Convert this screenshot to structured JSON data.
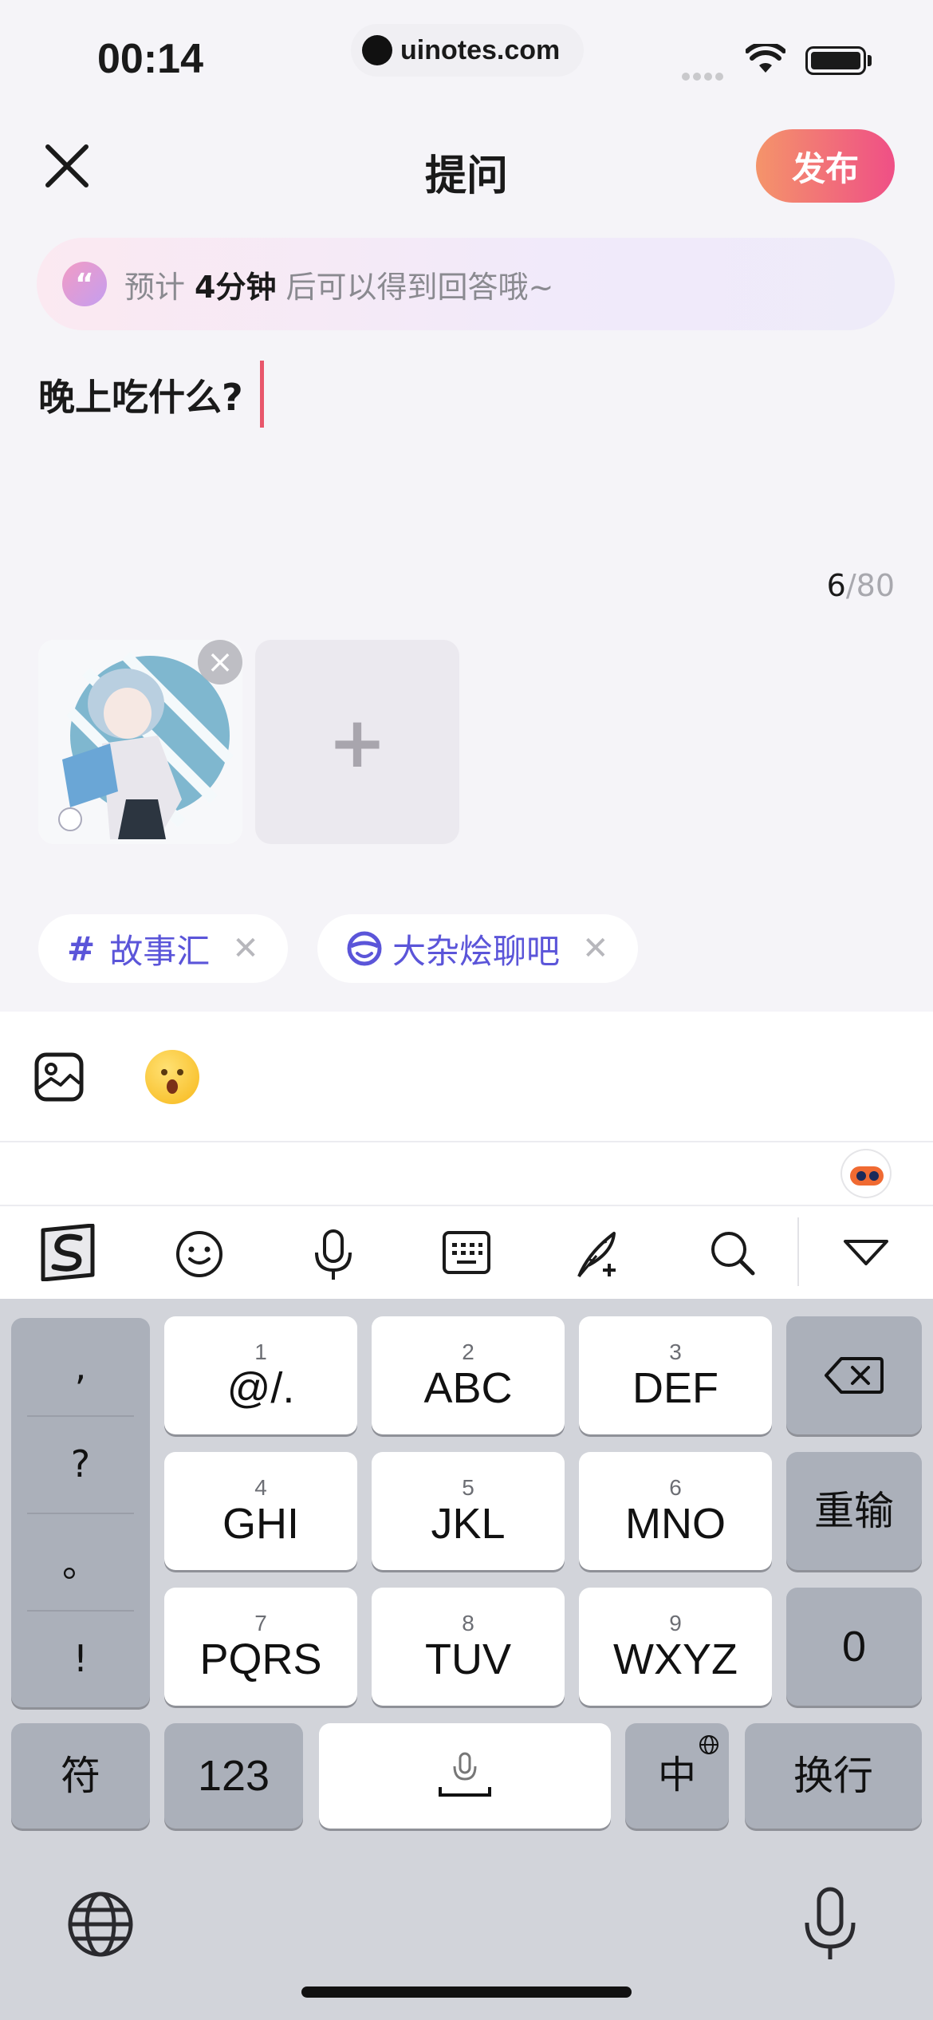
{
  "status_bar": {
    "time": "00:14",
    "url": "uinotes.com"
  },
  "header": {
    "title": "提问",
    "publish_label": "发布"
  },
  "tip": {
    "prefix": "预计",
    "highlight": "4分钟",
    "suffix": "后可以得到回答哦~",
    "icon": "quote-bubble-icon"
  },
  "question": {
    "text": "晚上吃什么?"
  },
  "counter": {
    "current": "6",
    "max": "/80"
  },
  "tags": [
    {
      "icon": "#",
      "label": "故事汇"
    },
    {
      "icon": "smiley-icon",
      "label": "大杂烩聊吧"
    }
  ],
  "keyboard": {
    "punct": [
      ",",
      "?",
      "。",
      "!"
    ],
    "keys": [
      {
        "num": "1",
        "label": "@/."
      },
      {
        "num": "2",
        "label": "ABC"
      },
      {
        "num": "3",
        "label": "DEF"
      },
      {
        "num": "4",
        "label": "GHI"
      },
      {
        "num": "5",
        "label": "JKL"
      },
      {
        "num": "6",
        "label": "MNO"
      },
      {
        "num": "7",
        "label": "PQRS"
      },
      {
        "num": "8",
        "label": "TUV"
      },
      {
        "num": "9",
        "label": "WXYZ"
      }
    ],
    "reenter": "重输",
    "zero": "0",
    "symbols": "符",
    "numbers": "123",
    "lang": "中",
    "return": "换行"
  },
  "colors": {
    "accent": "#5b55d9",
    "publish_start": "#f4946a",
    "publish_end": "#ef4f86",
    "caret": "#e8566b"
  }
}
